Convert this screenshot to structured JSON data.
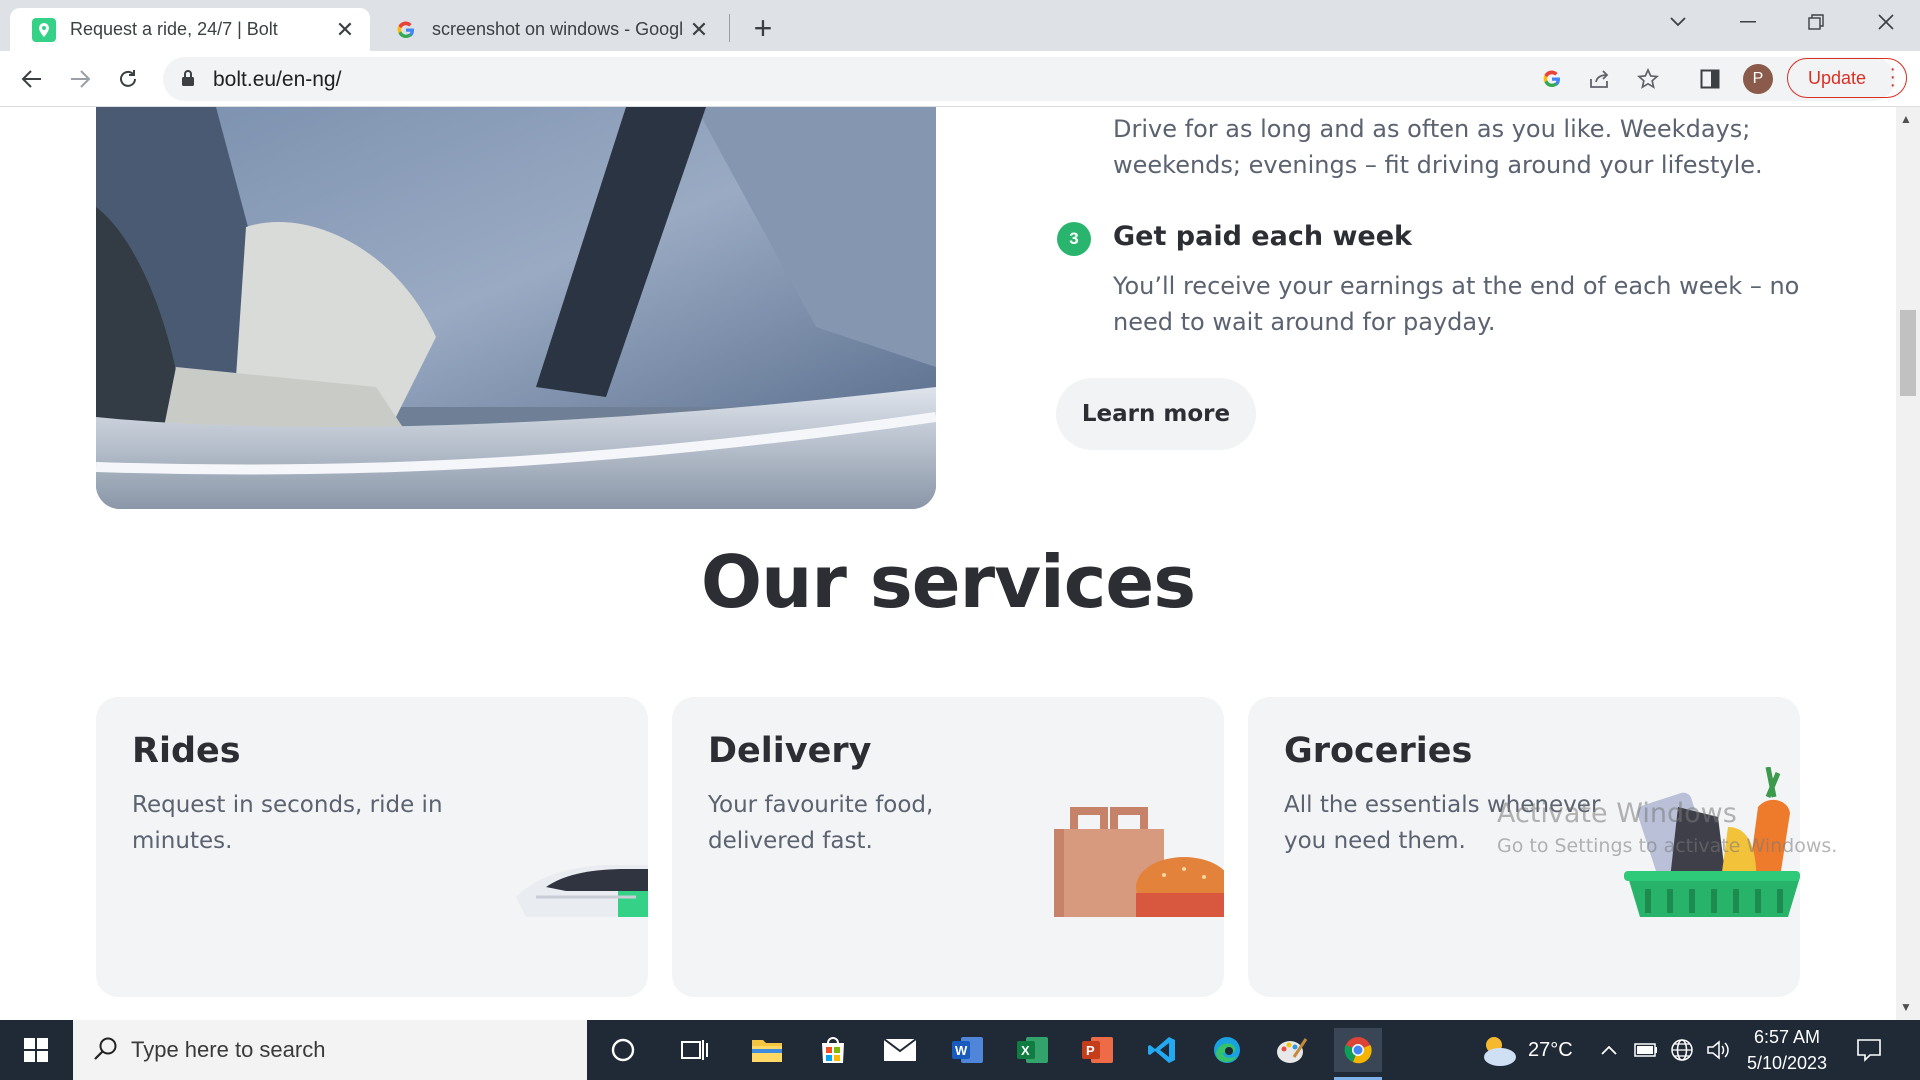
{
  "browser": {
    "tabs": [
      {
        "title": "Request a ride, 24/7 | Bolt",
        "active": true
      },
      {
        "title": "screenshot on windows - Google",
        "active": false
      }
    ],
    "url": "bolt.eu/en-ng/",
    "update_label": "Update",
    "profile_initial": "P"
  },
  "page": {
    "step2_text_line1": "Drive for as long and as often as you like. Weekdays;",
    "step2_text_line2": "weekends; evenings – fit driving around your lifestyle.",
    "step3": {
      "number": "3",
      "title": "Get paid each week",
      "text_line1": "You’ll receive your earnings at the end of each week – no",
      "text_line2": "need to wait around for payday."
    },
    "learn_more": "Learn more",
    "services_title": "Our services",
    "services": [
      {
        "title": "Rides",
        "line1": "Request in seconds, ride in",
        "line2": "minutes."
      },
      {
        "title": "Delivery",
        "line1": "Your favourite food,",
        "line2": "delivered fast."
      },
      {
        "title": "Groceries",
        "line1": "All the essentials whenever",
        "line2": "you need them."
      }
    ]
  },
  "watermark": {
    "line1": "Activate Windows",
    "line2": "Go to Settings to activate Windows."
  },
  "taskbar": {
    "search_placeholder": "Type here to search",
    "temperature": "27°C",
    "time": "6:57 AM",
    "date": "5/10/2023"
  },
  "colors": {
    "bolt_green": "#34d186",
    "step_badge": "#2ab56f",
    "update_red": "#d93025",
    "taskbar_bg": "#1f2a36"
  }
}
